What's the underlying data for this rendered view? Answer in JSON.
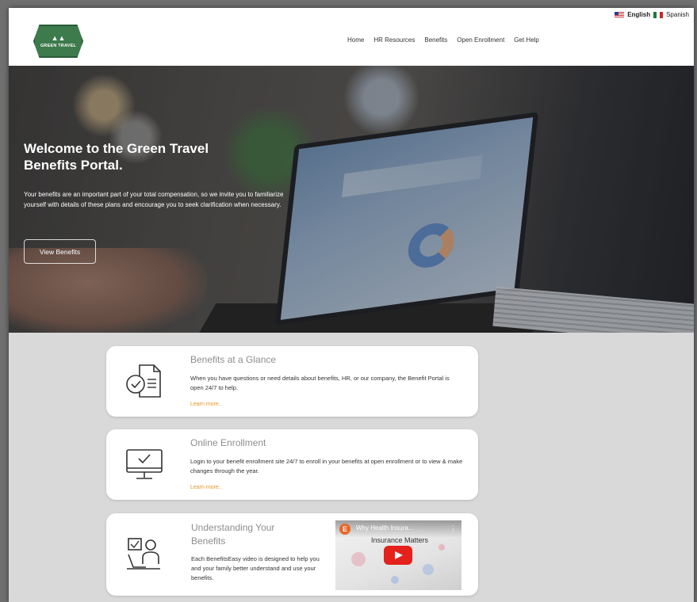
{
  "header": {
    "logo_text": "GREEN TRAVEL",
    "languages": [
      {
        "label": "English",
        "flag": "us-flag-icon"
      },
      {
        "label": "Spanish",
        "flag": "mx-flag-icon"
      }
    ],
    "nav": [
      "Home",
      "HR Resources",
      "Benefits",
      "Open Enrollment",
      "Get Help"
    ]
  },
  "hero": {
    "title": "Welcome to the Green Travel Benefits Portal.",
    "text": "Your benefits are an important part of your total compensation, so we invite you to familiarize yourself with details of these plans and encourage you to seek clarification when necessary.",
    "button": "View Benefits"
  },
  "cards": [
    {
      "title": "Benefits at a Glance",
      "text": "When you have questions or need details about benefits, HR, or our company, the Benefit Portal is open 24/7 to help.",
      "link": "Learn more..",
      "icon": "document-check-icon"
    },
    {
      "title": "Online Enrollment",
      "text": "Login to your benefit enrollment site 24/7 to enroll in your benefits at open enrollment or to view & make changes through the year.",
      "link": "Learn more..",
      "icon": "monitor-check-icon"
    },
    {
      "title": "Understanding Your Benefits",
      "text": "Each BenefitsEasy video is designed to help you and your family better understand and use your benefits.",
      "icon": "person-checklist-icon",
      "video": {
        "title": "Why Health Insura...",
        "subtitle": "Insurance Matters"
      }
    }
  ],
  "colors": {
    "brand_green": "#3d7a4c",
    "link_orange": "#e4961f",
    "youtube_red": "#e4211b"
  }
}
